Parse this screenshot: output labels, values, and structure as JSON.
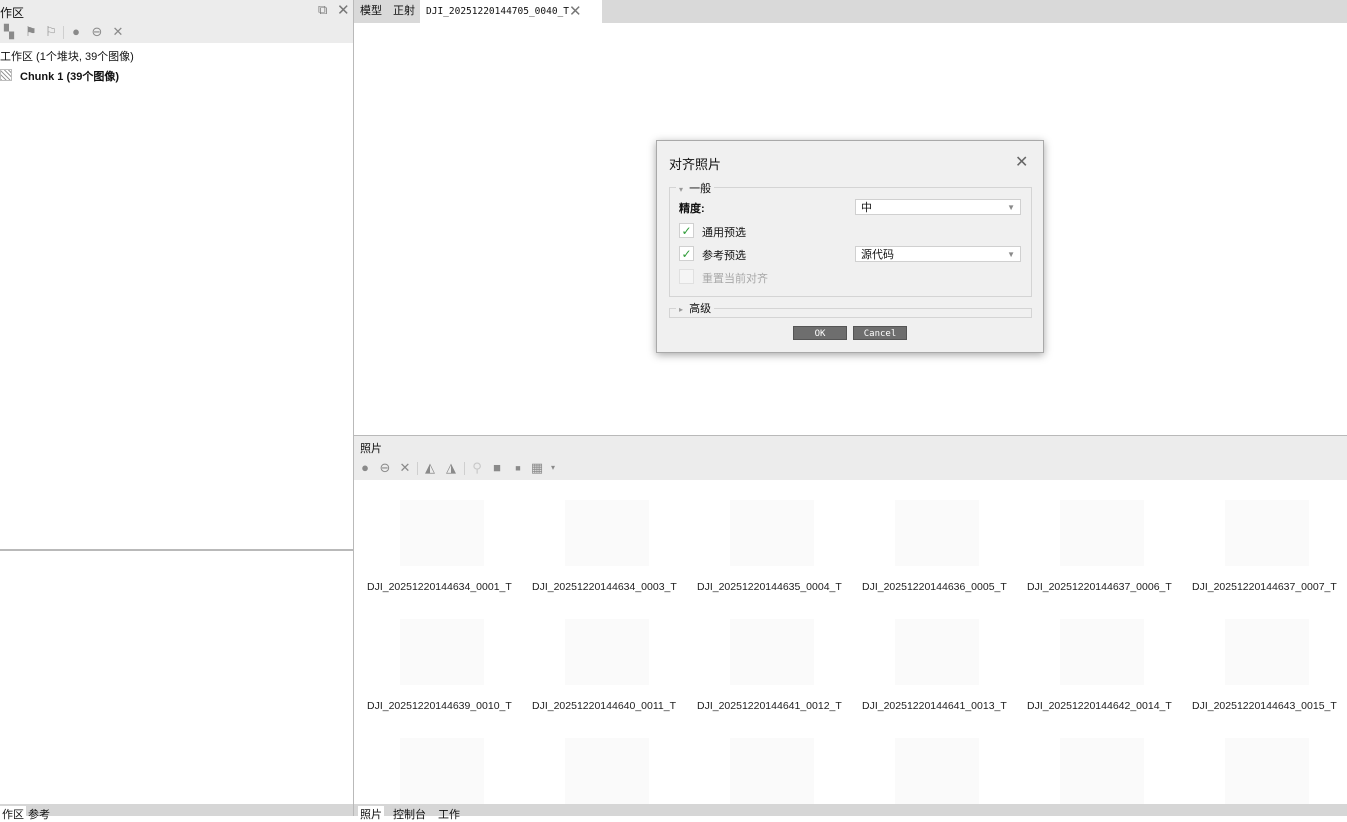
{
  "left_panel": {
    "title": "作区",
    "tree_root": "工作区 (1个堆块, 39个图像)",
    "chunk": "Chunk 1 (39个图像)",
    "bottom_tabs": [
      "作区",
      "参考"
    ],
    "toolbar_icons": [
      "add-chunk-icon",
      "add-photos-icon",
      "add-folder-icon",
      "enable-icon",
      "disable-icon",
      "remove-icon"
    ]
  },
  "tabs": [
    {
      "label": "模型"
    },
    {
      "label": "正射"
    },
    {
      "label": "DJI_20251220144705_0040_T"
    }
  ],
  "dialog": {
    "title": "对齐照片",
    "group_general": "一般",
    "accuracy_label": "精度:",
    "accuracy_value": "中",
    "generic_preselection": {
      "label": "通用预选",
      "checked": true
    },
    "reference_preselection": {
      "label": "参考预选",
      "checked": true,
      "value": "源代码"
    },
    "reset_alignment": {
      "label": "重置当前对齐",
      "checked": false,
      "enabled": false
    },
    "group_advanced": "高级",
    "ok": "OK",
    "cancel": "Cancel"
  },
  "photos_panel": {
    "title": "照片",
    "toolbar_icons": [
      "enable-icon",
      "disable-icon",
      "remove-icon",
      "rotate-left-icon",
      "rotate-right-icon",
      "filter-icon",
      "mask-icon",
      "small-icon",
      "grid-view-icon"
    ],
    "row1": [
      "DJI_20251220144634_0001_T",
      "DJI_20251220144634_0003_T",
      "DJI_20251220144635_0004_T",
      "DJI_20251220144636_0005_T",
      "DJI_20251220144637_0006_T",
      "DJI_20251220144637_0007_T"
    ],
    "row2": [
      "DJI_20251220144639_0010_T",
      "DJI_20251220144640_0011_T",
      "DJI_20251220144641_0012_T",
      "DJI_20251220144641_0013_T",
      "DJI_20251220144642_0014_T",
      "DJI_20251220144643_0015_T"
    ]
  },
  "bottom_tabs": [
    "照片",
    "控制台",
    "工作"
  ],
  "colors": {
    "check": "#2e9b37",
    "panel_bg": "#ececec",
    "button_bg": "#6e6e6e"
  }
}
